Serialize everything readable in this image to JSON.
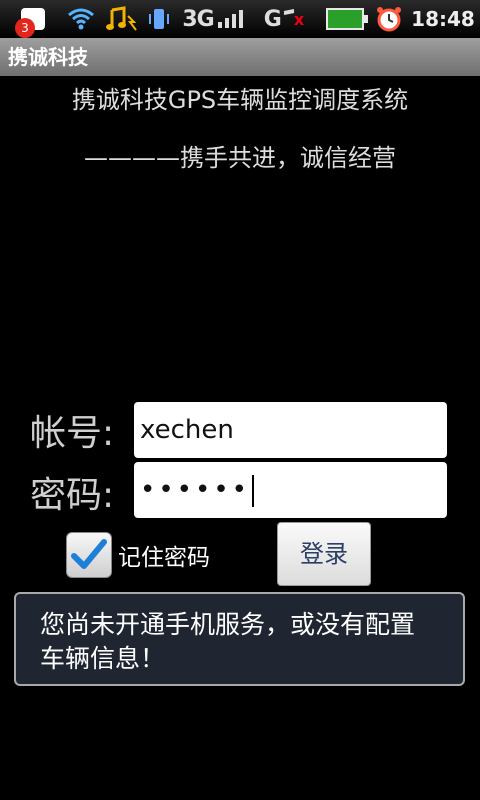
{
  "status_bar": {
    "notification_count": "3",
    "network_3g": "3G",
    "network_g": "G",
    "network_g_error": "x",
    "time": "18:48",
    "icons": [
      "notification-icon",
      "wifi-icon",
      "music-icon",
      "vibrate-icon",
      "signal-icon",
      "battery-icon",
      "alarm-icon"
    ]
  },
  "app": {
    "title": "携诚科技"
  },
  "content": {
    "system_title": "携诚科技GPS车辆监控调度系统",
    "slogan": "————携手共进，诚信经营"
  },
  "login_form": {
    "account_label": "帐号:",
    "account_value": "xechen",
    "password_label": "密码:",
    "password_masked": "••••••",
    "remember_label": "记住密码",
    "remember_checked": true,
    "login_button": "登录"
  },
  "toast": {
    "message": "您尚未开通手机服务，或没有配置车辆信息！"
  },
  "colors": {
    "background": "#000000",
    "title_bar": "#8a8a8a",
    "toast_bg": "#1f2631",
    "button_text": "#2a3e66",
    "checkbox_check": "#1e7fd6"
  }
}
